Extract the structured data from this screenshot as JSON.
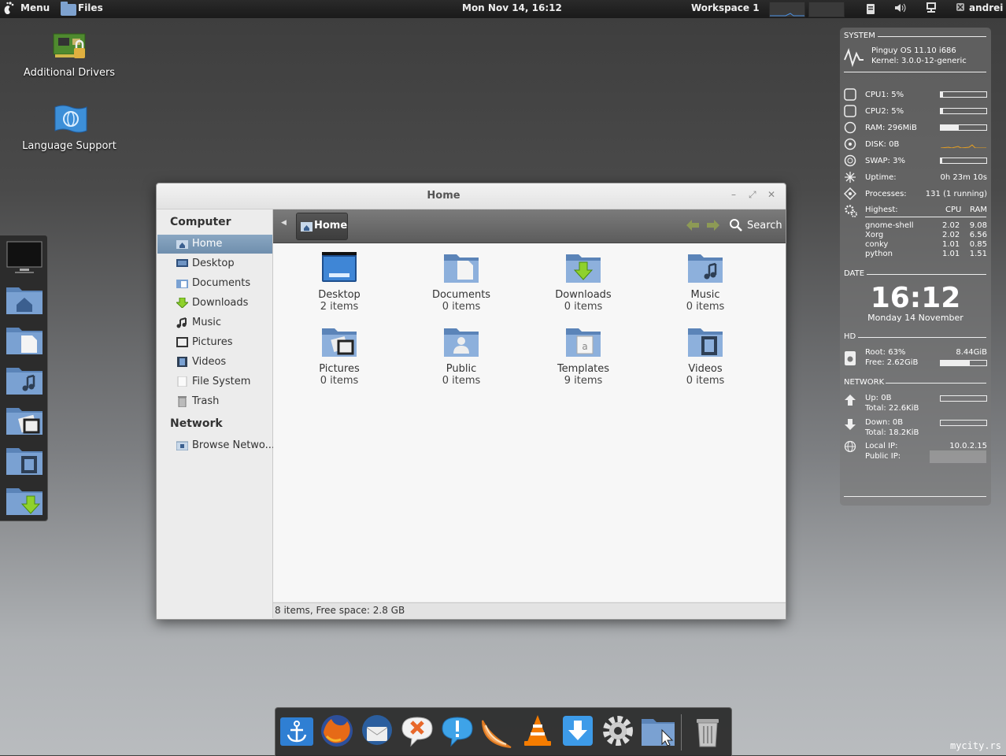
{
  "top_panel": {
    "menu_label": "Menu",
    "files_label": "Files",
    "datetime": "Mon Nov 14, 16:12",
    "workspace": "Workspace 1",
    "user": "andrei"
  },
  "desktop_icons": [
    {
      "label": "Additional Drivers",
      "icon": "driver-board-icon"
    },
    {
      "label": "Language Support",
      "icon": "language-flag-icon"
    }
  ],
  "launcher_icons": [
    "monitor-icon",
    "home-folder-icon",
    "documents-folder-icon",
    "music-folder-icon",
    "pictures-folder-icon",
    "videos-folder-icon",
    "downloads-folder-icon"
  ],
  "window": {
    "title": "Home",
    "sidebar": {
      "computer_heading": "Computer",
      "items": [
        {
          "label": "Home",
          "icon": "home-icon",
          "selected": true
        },
        {
          "label": "Desktop",
          "icon": "desktop-icon"
        },
        {
          "label": "Documents",
          "icon": "documents-icon"
        },
        {
          "label": "Downloads",
          "icon": "downloads-icon"
        },
        {
          "label": "Music",
          "icon": "music-icon"
        },
        {
          "label": "Pictures",
          "icon": "pictures-icon"
        },
        {
          "label": "Videos",
          "icon": "videos-icon"
        },
        {
          "label": "File System",
          "icon": "filesystem-icon"
        },
        {
          "label": "Trash",
          "icon": "trash-icon"
        }
      ],
      "network_heading": "Network",
      "network_items": [
        {
          "label": "Browse Netwo...",
          "icon": "network-icon"
        }
      ]
    },
    "toolbar": {
      "breadcrumb": "Home",
      "search_label": "Search"
    },
    "files": [
      {
        "name": "Desktop",
        "count": "2 items",
        "icon": "desktop-folder-icon"
      },
      {
        "name": "Documents",
        "count": "0 items",
        "icon": "documents-folder-icon"
      },
      {
        "name": "Downloads",
        "count": "0 items",
        "icon": "downloads-folder-icon"
      },
      {
        "name": "Music",
        "count": "0 items",
        "icon": "music-folder-icon"
      },
      {
        "name": "Pictures",
        "count": "0 items",
        "icon": "pictures-folder-icon"
      },
      {
        "name": "Public",
        "count": "0 items",
        "icon": "public-folder-icon"
      },
      {
        "name": "Templates",
        "count": "9 items",
        "icon": "templates-folder-icon"
      },
      {
        "name": "Videos",
        "count": "0 items",
        "icon": "videos-folder-icon"
      }
    ],
    "status": "8 items, Free space: 2.8 GB"
  },
  "conky": {
    "system_heading": "SYSTEM",
    "os": "Pinguy OS 11.10 i686",
    "kernel": "Kernel: 3.0.0-12-generic",
    "cpu1": "CPU1: 5%",
    "cpu1_pct": 5,
    "cpu2": "CPU2: 5%",
    "cpu2_pct": 5,
    "ram": "RAM: 296MiB",
    "ram_pct": 40,
    "disk": "DISK: 0B",
    "swap": "SWAP: 3%",
    "swap_pct": 3,
    "uptime_label": "Uptime:",
    "uptime": "0h 23m 10s",
    "processes_label": "Processes:",
    "processes": "131 (1 running)",
    "highest_label": "Highest:",
    "cpu_col": "CPU",
    "ram_col": "RAM",
    "procs": [
      {
        "name": "gnome-shell",
        "cpu": "2.02",
        "ram": "9.08"
      },
      {
        "name": "Xorg",
        "cpu": "2.02",
        "ram": "6.56"
      },
      {
        "name": "conky",
        "cpu": "1.01",
        "ram": "0.85"
      },
      {
        "name": "python",
        "cpu": "1.01",
        "ram": "1.51"
      }
    ],
    "date_heading": "DATE",
    "clock": "16:12",
    "date": "Monday 14 November",
    "hd_heading": "HD",
    "root": "Root: 63%",
    "root_size": "8.44GiB",
    "free": "Free: 2.62GiB",
    "root_pct": 63,
    "network_heading": "NETWORK",
    "up": "Up: 0B",
    "up_total": "Total: 22.6KiB",
    "down": "Down: 0B",
    "down_total": "Total: 18.2KiB",
    "local_ip_label": "Local IP:",
    "local_ip": "10.0.2.15",
    "public_ip_label": "Public IP:"
  },
  "dock_icons": [
    "anchor-icon",
    "firefox-icon",
    "thunderbird-icon",
    "xchat-icon",
    "notifications-icon",
    "orange-slice-icon",
    "vlc-icon",
    "download-icon",
    "settings-gear-icon",
    "file-manager-icon",
    "trash-can-icon"
  ],
  "watermark": "mycity.rs",
  "colors": {
    "accent": "#6f8ead",
    "folder": "#6f94c3"
  }
}
